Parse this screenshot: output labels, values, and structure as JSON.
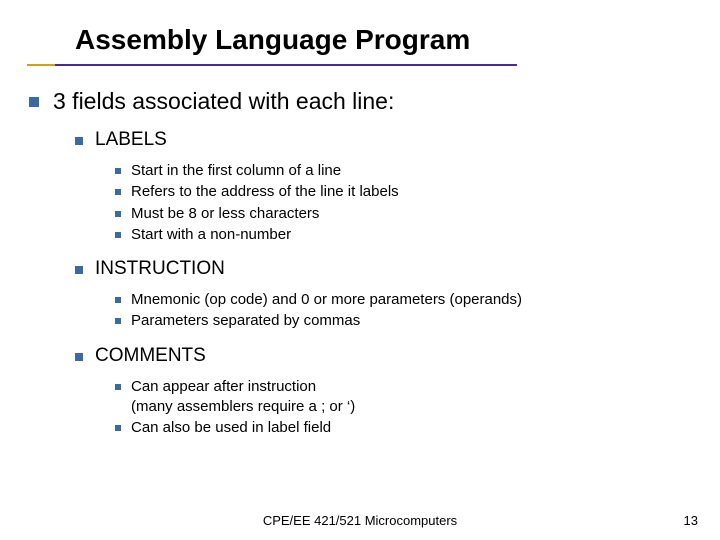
{
  "title": "Assembly Language Program",
  "heading": "3 fields associated with each line:",
  "sections": [
    {
      "label": "LABELS",
      "items": [
        "Start in the first column of a line",
        "Refers to the address of the line it labels",
        "Must be 8 or less characters",
        "Start with a non-number"
      ]
    },
    {
      "label": "INSTRUCTION",
      "items": [
        "Mnemonic (op code) and 0 or more parameters (operands)",
        "Parameters separated by commas"
      ]
    },
    {
      "label": "COMMENTS",
      "items": [
        "Can appear after instruction\n(many assemblers require a ; or ‘)",
        "Can also be used in label field"
      ]
    }
  ],
  "footer": "CPE/EE 421/521 Microcomputers",
  "page": "13"
}
